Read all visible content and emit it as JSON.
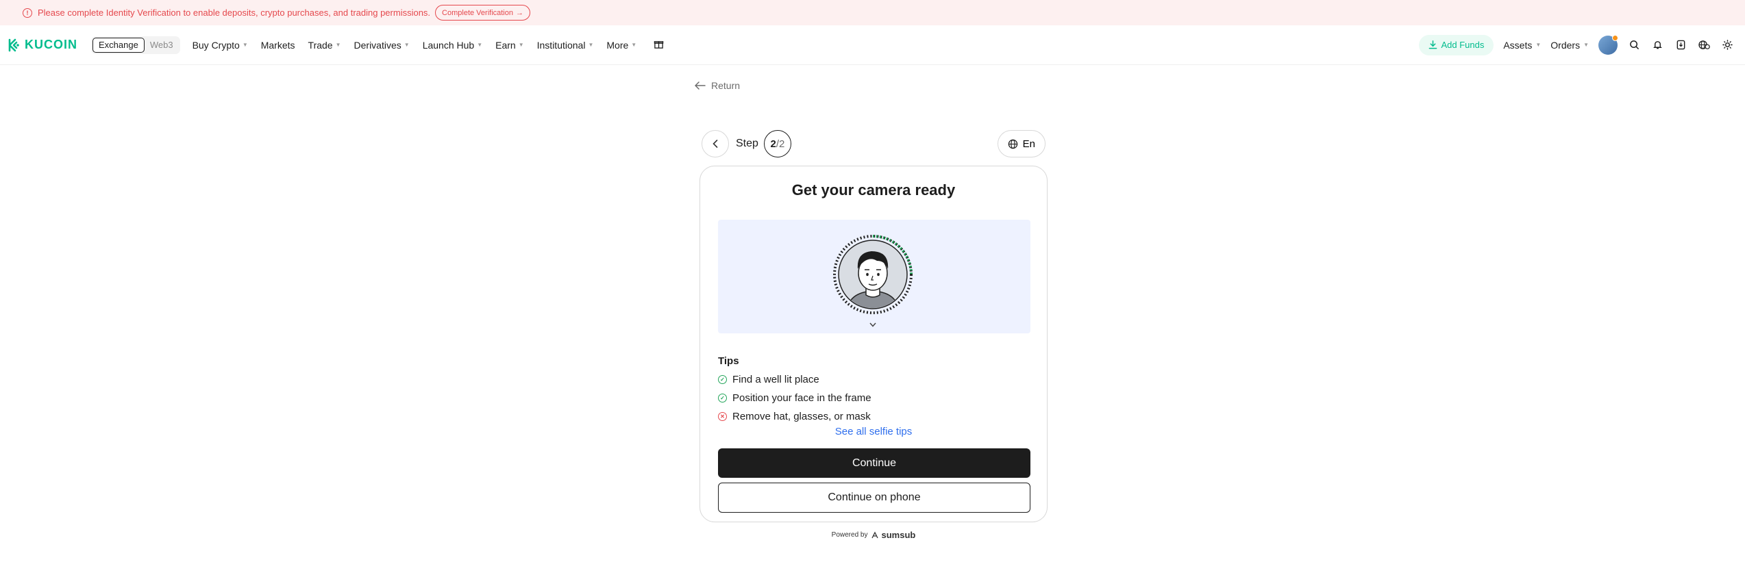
{
  "alert": {
    "message": "Please complete Identity Verification to enable deposits, crypto purchases, and trading permissions.",
    "button_label": "Complete Verification"
  },
  "nav": {
    "logo_text": "KUCOIN",
    "switch": [
      "Exchange",
      "Web3"
    ],
    "active_switch": "Exchange",
    "menu": [
      "Buy Crypto",
      "Markets",
      "Trade",
      "Derivatives",
      "Launch Hub",
      "Earn",
      "Institutional",
      "More"
    ],
    "add_funds": "Add Funds",
    "assets": "Assets",
    "orders": "Orders"
  },
  "page": {
    "return_label": "Return",
    "step_label": "Step",
    "step_current": "2",
    "step_separator": "/",
    "step_total": "2",
    "language": "En"
  },
  "card": {
    "title": "Get your camera ready",
    "tips_title": "Tips",
    "tips": [
      {
        "text": "Find a well lit place",
        "status": "ok"
      },
      {
        "text": "Position your face in the frame",
        "status": "ok"
      },
      {
        "text": "Remove hat, glasses, or mask",
        "status": "bad"
      }
    ],
    "see_all": "See all selfie tips",
    "continue": "Continue",
    "continue_phone": "Continue on phone"
  },
  "footer": {
    "powered_by": "Powered by",
    "brand": "sumsub"
  },
  "colors": {
    "brand": "#01bc8d",
    "alert": "#e5484d",
    "link": "#2f6fed"
  }
}
